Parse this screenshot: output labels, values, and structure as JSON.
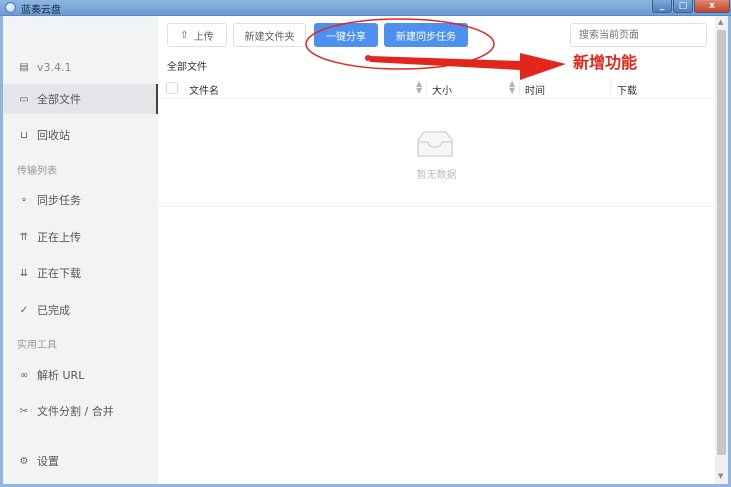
{
  "window": {
    "title": "蓝奏云盘"
  },
  "sidebar": {
    "version": "v3.4.1",
    "items": [
      {
        "label": "全部文件",
        "icon": "folder-icon"
      },
      {
        "label": "回收站",
        "icon": "trash-icon"
      },
      {
        "label": "同步任务",
        "icon": "sync-icon"
      },
      {
        "label": "正在上传",
        "icon": "upload-cloud-icon"
      },
      {
        "label": "正在下载",
        "icon": "download-cloud-icon"
      },
      {
        "label": "已完成",
        "icon": "check-circle-icon"
      },
      {
        "label": "解析 URL",
        "icon": "link-icon"
      },
      {
        "label": "文件分割 / 合并",
        "icon": "scissors-icon"
      },
      {
        "label": "设置",
        "icon": "gear-icon"
      }
    ],
    "sections": {
      "transfer": "传输列表",
      "tools": "实用工具"
    }
  },
  "toolbar": {
    "upload": "上传",
    "new_folder": "新建文件夹",
    "one_click_share": "一键分享",
    "new_sync_task": "新建同步任务",
    "search_placeholder": "搜索当前页面"
  },
  "breadcrumb": "全部文件",
  "table": {
    "columns": [
      "文件名",
      "大小",
      "时间",
      "下载"
    ],
    "empty_text": "暂无数据"
  },
  "annotation": {
    "text": "新增功能",
    "color": "#e2261c"
  },
  "colors": {
    "primary": "#4d90f0",
    "sidebar_bg": "#f2f3f5",
    "titlebar": "#7aa5da"
  }
}
